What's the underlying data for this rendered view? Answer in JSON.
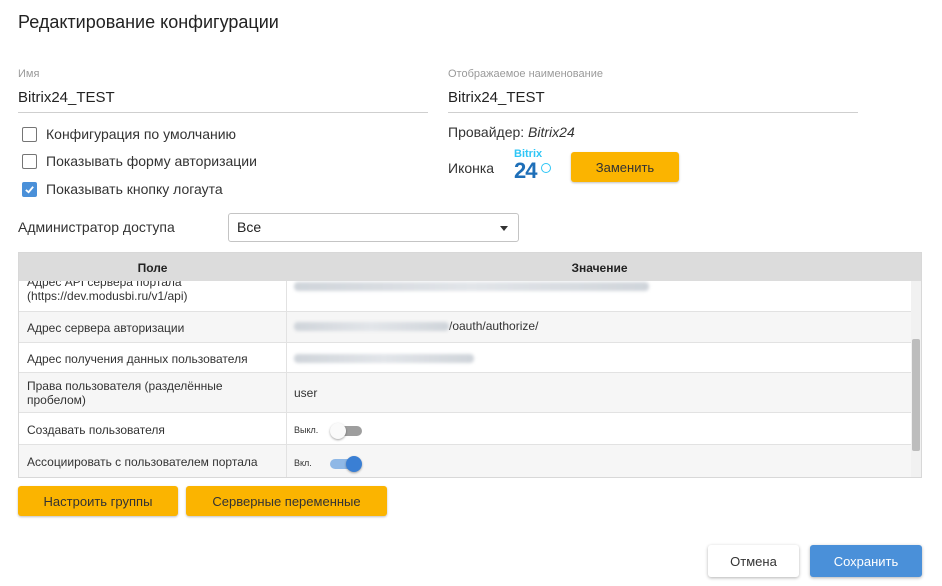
{
  "dialog": {
    "title": "Редактирование конфигурации"
  },
  "name_field": {
    "label": "Имя",
    "value": "Bitrix24_TEST"
  },
  "display_field": {
    "label": "Отображаемое наименование",
    "value": "Bitrix24_TEST"
  },
  "checkboxes": [
    {
      "label": "Конфигурация по умолчанию",
      "checked": false
    },
    {
      "label": "Показывать форму авторизации",
      "checked": false
    },
    {
      "label": "Показывать кнопку логаута",
      "checked": true
    }
  ],
  "provider": {
    "label": "Провайдер:",
    "value": "Bitrix24"
  },
  "icon": {
    "label": "Иконка",
    "logo_line1": "Bitrix",
    "logo_line2": "24",
    "replace_button": "Заменить"
  },
  "admin": {
    "label": "Администратор доступа",
    "selected": "Все"
  },
  "grid": {
    "headers": {
      "field": "Поле",
      "value": "Значение"
    },
    "rows": [
      {
        "field": "Адрес API сервера портала\n(https://dev.modusbi.ru/v1/api)",
        "value": "https://dev.modusbi.ru/v1/api/?appid=26&object=login&cmd=create"
      },
      {
        "field": "Адрес сервера авторизации",
        "value": "/oauth/authorize/"
      },
      {
        "field": "Адрес получения данных пользователя",
        "value": ""
      },
      {
        "field": "Права пользователя (разделённые пробелом)",
        "value": "user"
      },
      {
        "field": "Создавать пользователя",
        "toggle_label": "Выкл.",
        "toggle_on": false
      },
      {
        "field": "Ассоциировать с пользователем портала",
        "toggle_label": "Вкл.",
        "toggle_on": true
      }
    ]
  },
  "buttons": {
    "groups": "Настроить группы",
    "server_vars": "Серверные переменные",
    "cancel": "Отмена",
    "save": "Сохранить"
  },
  "colors": {
    "accent": "#4a90d9",
    "orange": "#fbb400"
  }
}
